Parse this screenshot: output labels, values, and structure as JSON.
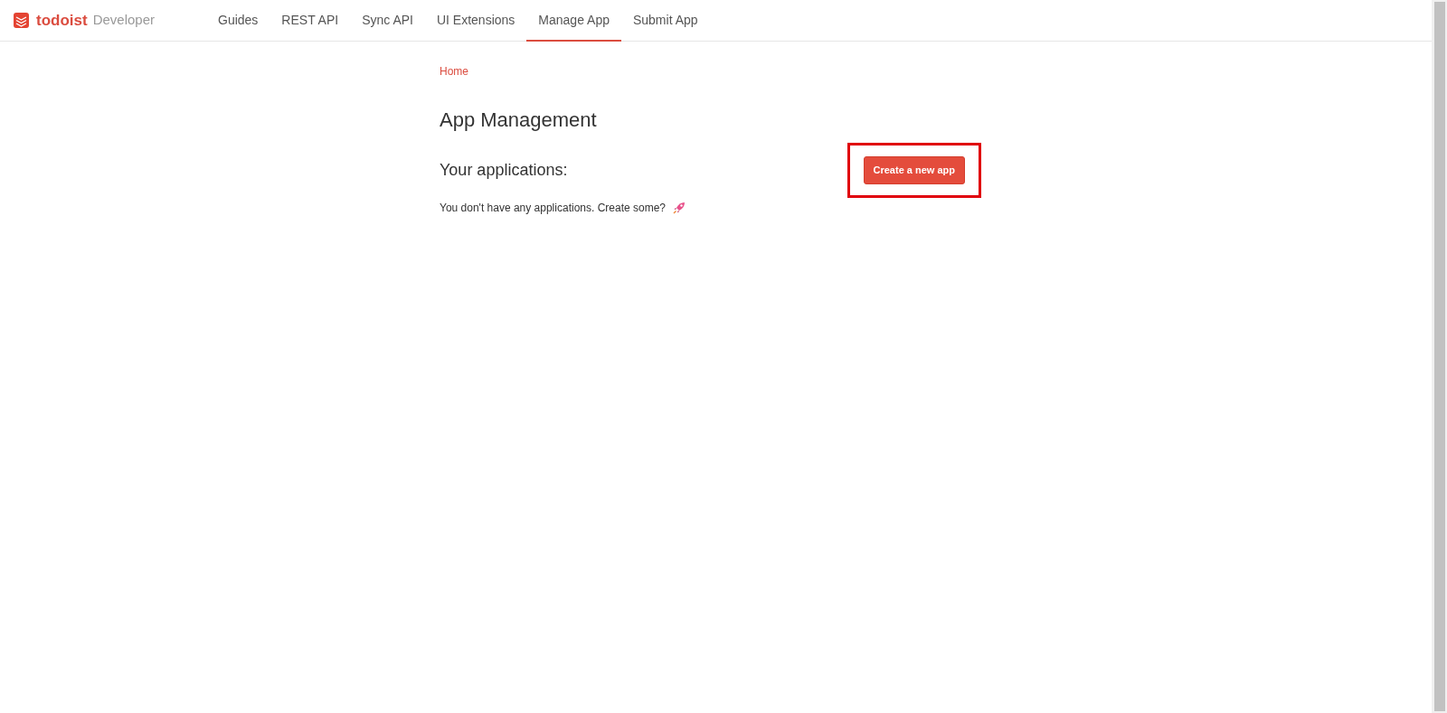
{
  "brand": {
    "name": "todoist",
    "suffix": "Developer"
  },
  "nav": [
    {
      "label": "Guides",
      "selected": false
    },
    {
      "label": "REST API",
      "selected": false
    },
    {
      "label": "Sync API",
      "selected": false
    },
    {
      "label": "UI Extensions",
      "selected": false
    },
    {
      "label": "Manage App",
      "selected": true
    },
    {
      "label": "Submit App",
      "selected": false
    }
  ],
  "breadcrumb": "Home",
  "title": "App Management",
  "subtitle": "Your applications:",
  "create_button": {
    "label": "Create a new app",
    "highlighted": true
  },
  "empty_message": "You don't have any applications. Create some?"
}
